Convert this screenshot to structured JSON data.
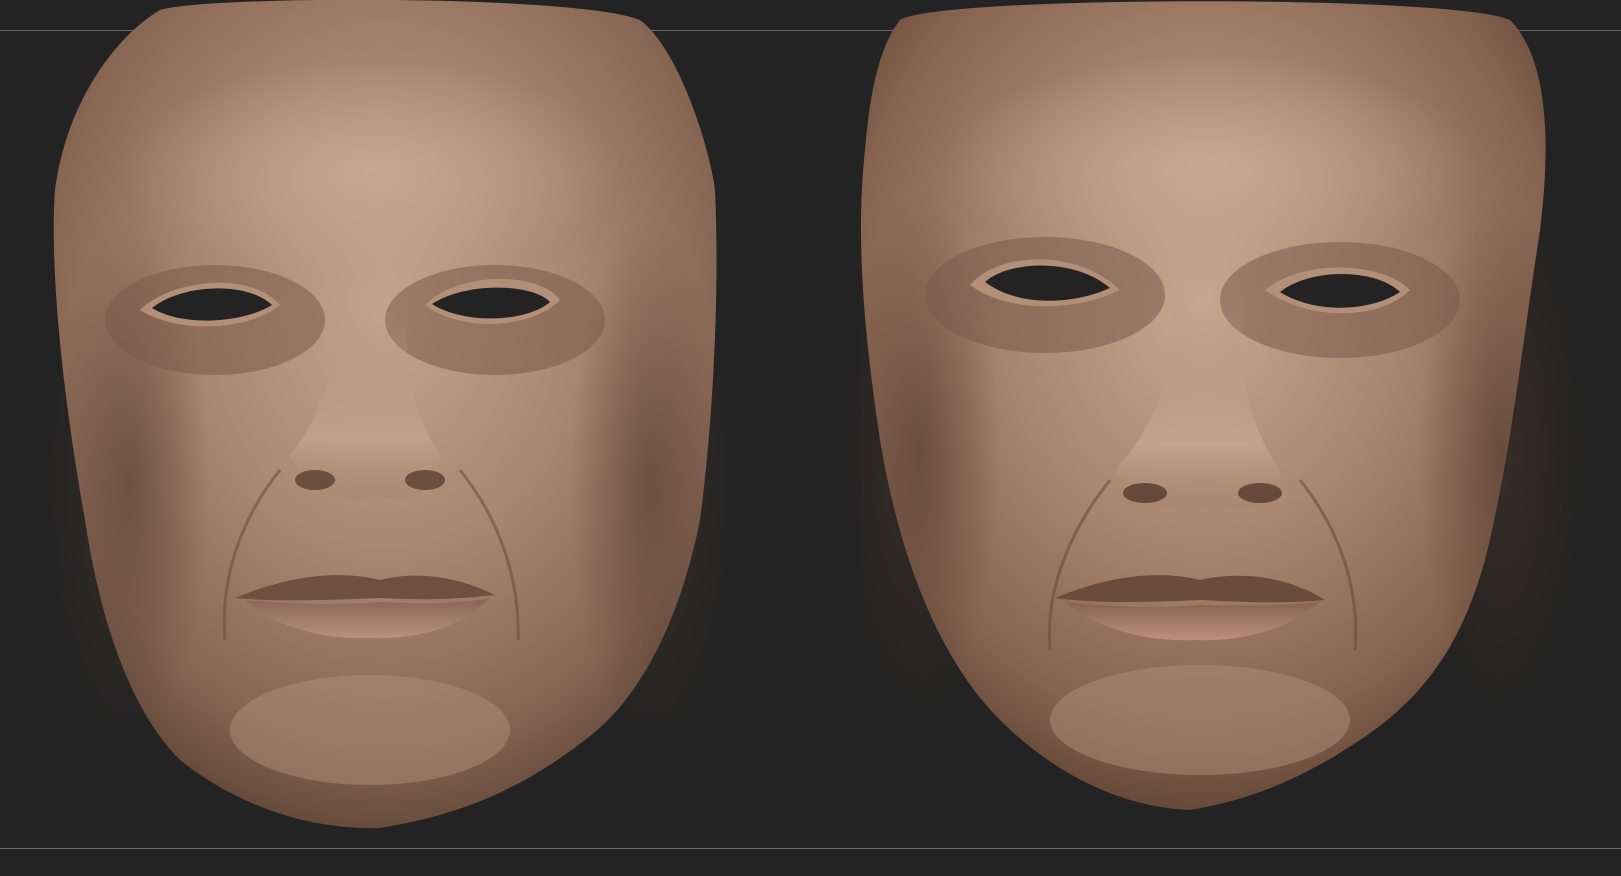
{
  "viewport": {
    "background_color": "#232323",
    "guide_line_color": "#6a6a6a"
  },
  "sculpts": [
    {
      "name": "left-face-render",
      "skin_base": "#a07f6a",
      "skin_highlight": "#c8a48c",
      "skin_shadow": "#5e4536",
      "eye_hole_color": "#232323"
    },
    {
      "name": "right-face-render",
      "skin_base": "#a37d68",
      "skin_highlight": "#caa68e",
      "skin_shadow": "#5c4233",
      "eye_hole_color": "#232323"
    }
  ]
}
